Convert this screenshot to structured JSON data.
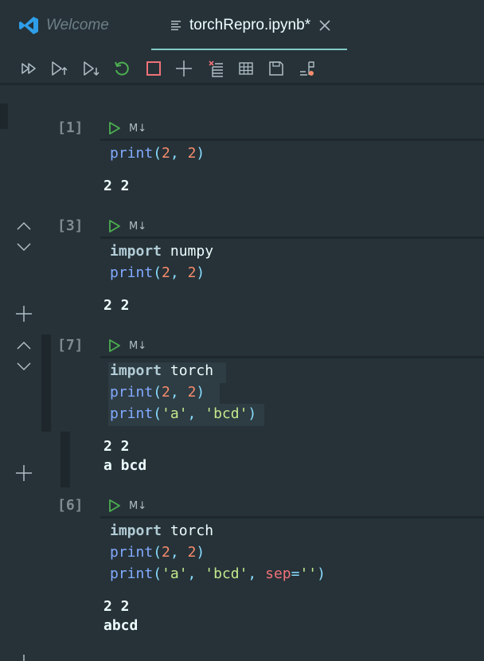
{
  "tabs": [
    {
      "label": "Welcome",
      "icon": "vscode-logo-icon",
      "active": false
    },
    {
      "label": "torchRepro.ipynb*",
      "icon": "document-lines-icon",
      "active": true
    }
  ],
  "toolbar": {
    "buttons": [
      "run-all-icon",
      "run-above-icon",
      "run-below-icon",
      "restart-kernel-icon",
      "interrupt-kernel-icon",
      "add-cell-icon",
      "clear-outputs-icon",
      "variable-explorer-icon",
      "save-icon",
      "export-icon"
    ]
  },
  "cells": [
    {
      "count": "[1]",
      "md_label": "M↓",
      "code": [
        [
          {
            "t": "print",
            "c": "fn"
          },
          {
            "t": "(",
            "c": "punct"
          },
          {
            "t": "2",
            "c": "num"
          },
          {
            "t": ", ",
            "c": "punct"
          },
          {
            "t": "2",
            "c": "num"
          },
          {
            "t": ")",
            "c": "punct"
          }
        ]
      ],
      "output": [
        "2 2"
      ]
    },
    {
      "count": "[3]",
      "md_label": "M↓",
      "code": [
        [
          {
            "t": "import",
            "c": "kw"
          },
          {
            "t": " numpy",
            "c": "plain"
          }
        ],
        [
          {
            "t": "print",
            "c": "fn"
          },
          {
            "t": "(",
            "c": "punct"
          },
          {
            "t": "2",
            "c": "num"
          },
          {
            "t": ", ",
            "c": "punct"
          },
          {
            "t": "2",
            "c": "num"
          },
          {
            "t": ")",
            "c": "punct"
          }
        ]
      ],
      "output": [
        "2 2"
      ]
    },
    {
      "count": "[7]",
      "md_label": "M↓",
      "code": [
        [
          {
            "t": "import",
            "c": "kw"
          },
          {
            "t": " torch",
            "c": "plain"
          }
        ],
        [
          {
            "t": "print",
            "c": "fn"
          },
          {
            "t": "(",
            "c": "punct"
          },
          {
            "t": "2",
            "c": "num"
          },
          {
            "t": ", ",
            "c": "punct"
          },
          {
            "t": "2",
            "c": "num"
          },
          {
            "t": ")",
            "c": "punct"
          }
        ],
        [
          {
            "t": "print",
            "c": "fn"
          },
          {
            "t": "(",
            "c": "punct"
          },
          {
            "t": "'a'",
            "c": "str"
          },
          {
            "t": ", ",
            "c": "punct"
          },
          {
            "t": "'bcd'",
            "c": "str"
          },
          {
            "t": ")",
            "c": "punct"
          }
        ]
      ],
      "output": [
        "2 2",
        "a bcd"
      ]
    },
    {
      "count": "[6]",
      "md_label": "M↓",
      "code": [
        [
          {
            "t": "import",
            "c": "kw"
          },
          {
            "t": " torch",
            "c": "plain"
          }
        ],
        [
          {
            "t": "print",
            "c": "fn"
          },
          {
            "t": "(",
            "c": "punct"
          },
          {
            "t": "2",
            "c": "num"
          },
          {
            "t": ", ",
            "c": "punct"
          },
          {
            "t": "2",
            "c": "num"
          },
          {
            "t": ")",
            "c": "punct"
          }
        ],
        [
          {
            "t": "print",
            "c": "fn"
          },
          {
            "t": "(",
            "c": "punct"
          },
          {
            "t": "'a'",
            "c": "str"
          },
          {
            "t": ", ",
            "c": "punct"
          },
          {
            "t": "'bcd'",
            "c": "str"
          },
          {
            "t": ", ",
            "c": "punct"
          },
          {
            "t": "sep",
            "c": "param"
          },
          {
            "t": "=",
            "c": "punct"
          },
          {
            "t": "''",
            "c": "str"
          },
          {
            "t": ")",
            "c": "punct"
          }
        ]
      ],
      "output": [
        "2 2",
        "abcd"
      ]
    }
  ],
  "colors": {
    "background": "#263238",
    "tab_underline": "#80cbc4",
    "run_green": "#4caf50",
    "stop_red": "#f07178",
    "keyword": "#b2ccd6",
    "function": "#82aaff",
    "number": "#f78c6c",
    "string": "#c3e88d",
    "parameter": "#f07178"
  }
}
